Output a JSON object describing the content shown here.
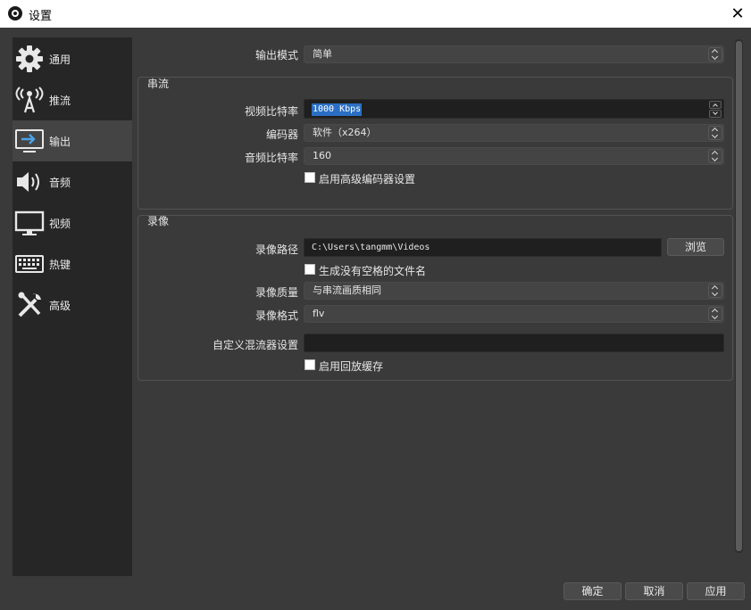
{
  "window": {
    "title": "设置",
    "close_glyph": "✕"
  },
  "sidebar": {
    "items": [
      {
        "label": "通用",
        "icon": "gear-icon",
        "selected": false
      },
      {
        "label": "推流",
        "icon": "broadcast-antenna-icon",
        "selected": false
      },
      {
        "label": "输出",
        "icon": "output-monitor-icon",
        "selected": true
      },
      {
        "label": "音频",
        "icon": "speaker-icon",
        "selected": false
      },
      {
        "label": "视频",
        "icon": "monitor-icon",
        "selected": false
      },
      {
        "label": "热键",
        "icon": "keyboard-icon",
        "selected": false
      },
      {
        "label": "高级",
        "icon": "tools-icon",
        "selected": false
      }
    ]
  },
  "output_mode": {
    "label": "输出模式",
    "value": "简单"
  },
  "streaming": {
    "title": "串流",
    "video_bitrate": {
      "label": "视频比特率",
      "value": "1000 Kbps"
    },
    "encoder": {
      "label": "编码器",
      "value": "软件（x264）"
    },
    "audio_bitrate": {
      "label": "音频比特率",
      "value": "160"
    },
    "advanced_encoder": {
      "label": "启用高级编码器设置",
      "checked": false
    }
  },
  "recording": {
    "title": "录像",
    "path": {
      "label": "录像路径",
      "value": "C:\\Users\\tangmm\\Videos",
      "browse_label": "浏览"
    },
    "no_space_filename": {
      "label": "生成没有空格的文件名",
      "checked": false
    },
    "quality": {
      "label": "录像质量",
      "value": "与串流画质相同"
    },
    "format": {
      "label": "录像格式",
      "value": "flv"
    },
    "custom_muxer": {
      "label": "自定义混流器设置",
      "value": ""
    },
    "replay_buffer": {
      "label": "启用回放缓存",
      "checked": false
    }
  },
  "footer": {
    "ok_label": "确定",
    "cancel_label": "取消",
    "apply_label": "应用"
  }
}
